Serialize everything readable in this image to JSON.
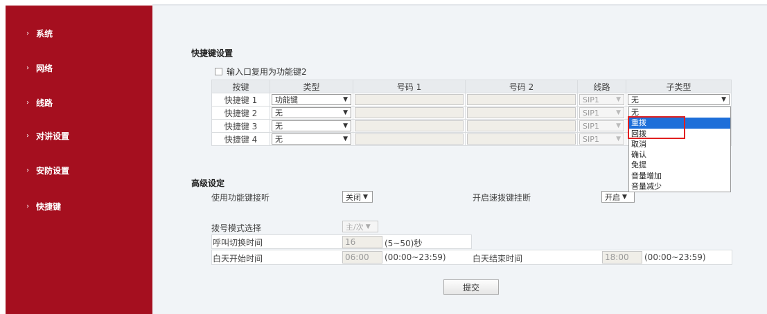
{
  "sidebar": {
    "items": [
      {
        "label": "系统"
      },
      {
        "label": "网络"
      },
      {
        "label": "线路"
      },
      {
        "label": "对讲设置"
      },
      {
        "label": "安防设置"
      },
      {
        "label": "快捷键"
      }
    ]
  },
  "quickkey": {
    "title": "快捷键设置",
    "checkbox_label": "输入口复用为功能键2",
    "headers": [
      "按键",
      "类型",
      "号码 1",
      "号码 2",
      "线路",
      "子类型"
    ],
    "rows": [
      {
        "key": "快捷键 1",
        "type": "功能键",
        "line": "SIP1",
        "subtype": "无"
      },
      {
        "key": "快捷键 2",
        "type": "无",
        "line": "SIP1"
      },
      {
        "key": "快捷键 3",
        "type": "无",
        "line": "SIP1"
      },
      {
        "key": "快捷键 4",
        "type": "无",
        "line": "SIP1"
      }
    ],
    "subtype_options": [
      "无",
      "重拨",
      "回拨",
      "取消",
      "确认",
      "免提",
      "音量增加",
      "音量减少"
    ],
    "subtype_highlighted": "重拨"
  },
  "advanced": {
    "title": "高级设定",
    "func_listen_label": "使用功能键接听",
    "func_listen_value": "关闭",
    "speed_hangup_label": "开启速拨键挂断",
    "speed_hangup_value": "开启",
    "dial_mode_label": "拨号模式选择",
    "dial_mode_value": "主/次",
    "call_switch_label": "呼叫切换时间",
    "call_switch_value": "16",
    "call_switch_hint": "(5~50)秒",
    "day_start_label": "白天开始时间",
    "day_start_value": "06:00",
    "day_start_hint": "(00:00~23:59)",
    "day_end_label": "白天结束时间",
    "day_end_value": "18:00",
    "day_end_hint": "(00:00~23:59)"
  },
  "submit_label": "提交",
  "colors": {
    "sidebar": "#a50f1f",
    "highlight": "#1e6fd9",
    "callout": "#e02020"
  }
}
